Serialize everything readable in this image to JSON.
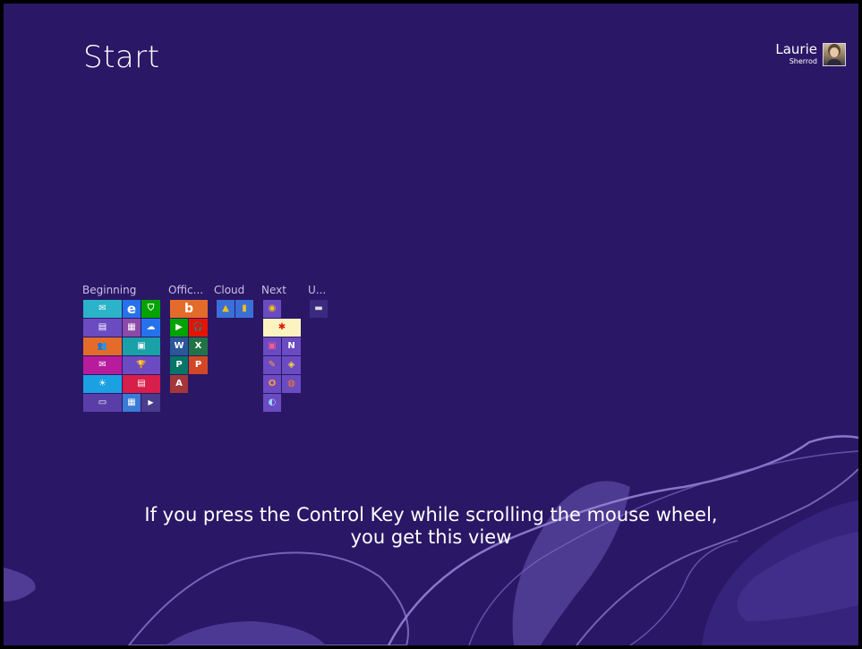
{
  "start": {
    "title": "Start"
  },
  "user": {
    "first_name": "Laurie",
    "last_name": "Sherrod"
  },
  "groups": [
    "Beginning",
    "Offic...",
    "Cloud",
    "Next",
    "U..."
  ],
  "tiles": {
    "mail": "✉",
    "ie": "e",
    "store": "⛉",
    "news": "▤",
    "maps": "▦",
    "skydrive": "☁",
    "people": "👥",
    "photos": "▣",
    "messaging": "✉",
    "sports": "🏆",
    "weather": "☀",
    "finance": "▤",
    "desktop": "▭",
    "video": "▶",
    "music": "🎧",
    "bing": "b",
    "word": "W",
    "excel": "X",
    "publisher": "P",
    "powerpoint": "P",
    "access": "A",
    "gdrive": "▲",
    "gdocs": "▮",
    "chrome": "◉",
    "paint": "✱",
    "project": "▣",
    "onenote": "N",
    "outlook": "O",
    "firefox": "◍",
    "misc1": "✎",
    "misc2": "◈",
    "misc3": "◐",
    "cmd": "▬",
    "vs": "∞",
    "gadget": "▦"
  },
  "caption": {
    "line1": "If you press the Control Key while scrolling the mouse wheel,",
    "line2": "you get this view"
  }
}
